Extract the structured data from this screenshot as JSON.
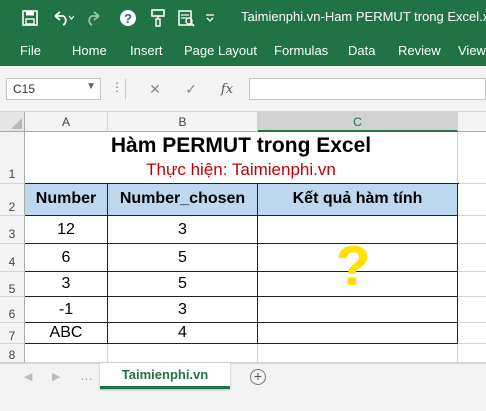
{
  "window": {
    "title": "Taimienphi.vn-Ham PERMUT trong Excel.xls",
    "quick_access": [
      "save-icon",
      "undo-icon",
      "redo-icon",
      "help-icon",
      "paint-brush-icon",
      "print-preview-icon"
    ]
  },
  "ribbon": {
    "tabs": [
      "File",
      "Home",
      "Insert",
      "Page Layout",
      "Formulas",
      "Data",
      "Review",
      "View"
    ]
  },
  "formula_bar": {
    "name_box": "C15",
    "fx_label": "fx",
    "formula": ""
  },
  "grid": {
    "columns": [
      "A",
      "B",
      "C"
    ],
    "selected_column": "C",
    "rows": [
      "1",
      "2",
      "3",
      "4",
      "5",
      "6",
      "7",
      "8"
    ]
  },
  "sheet": {
    "title": "Hàm PERMUT trong Excel",
    "subtitle": "Thực hiện: Taimienphi.vn",
    "headers": [
      "Number",
      "Number_chosen",
      "Kết quả hàm tính"
    ],
    "data_rows": [
      {
        "number": "12",
        "chosen": "3"
      },
      {
        "number": "6",
        "chosen": "5"
      },
      {
        "number": "3",
        "chosen": "5"
      },
      {
        "number": "-1",
        "chosen": "3"
      },
      {
        "number": "ABC",
        "chosen": "4"
      }
    ],
    "placeholder_mark": "?"
  },
  "sheet_tabs": {
    "active": "Taimienphi.vn",
    "nav_prev": "◀",
    "nav_next": "▶",
    "add_label": "+"
  },
  "colors": {
    "excel_green": "#217346",
    "header_fill": "#bdd7ee",
    "subtitle_red": "#c00000",
    "question_yellow": "#ffe000"
  }
}
